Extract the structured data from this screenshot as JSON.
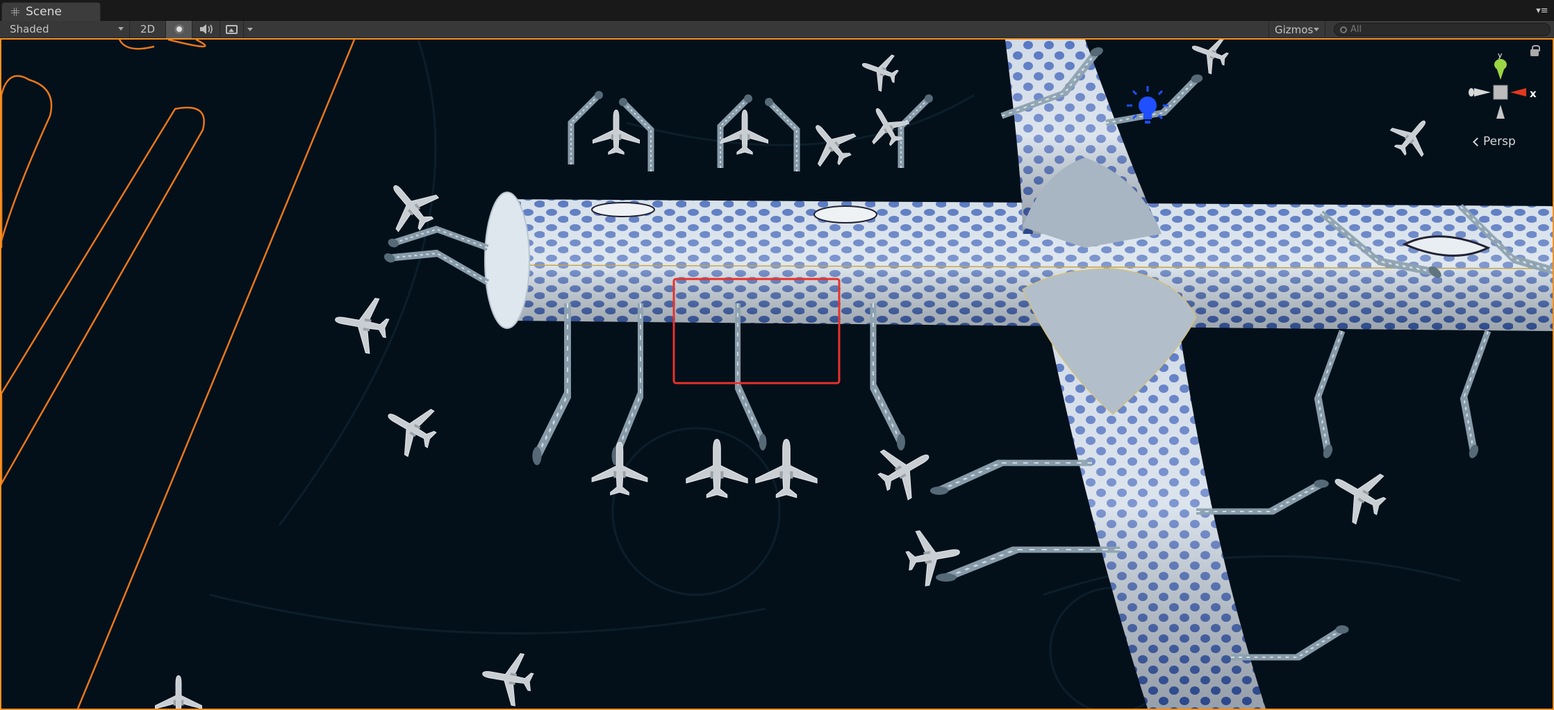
{
  "window": {
    "tab_title": "Scene",
    "tab_icon": "grid-icon",
    "menu_icon": "window-menu-icon"
  },
  "toolbar": {
    "shading_mode": "Shaded",
    "mode_2d_label": "2D",
    "lighting_icon": "scene-lighting-icon",
    "audio_icon": "scene-audio-icon",
    "effects_icon": "scene-effects-icon",
    "gizmos_label": "Gizmos",
    "search_placeholder": "All"
  },
  "viewport": {
    "projection_label": "Persp",
    "orientation_gizmo": {
      "x_axis_label": "x",
      "y_axis_label": "y",
      "axis_colors": {
        "x": "#e0391d",
        "y": "#8fcc3b",
        "z": "#3d6fe0"
      }
    },
    "selection_outline_color": "#f7911e",
    "highlight_box_color": "#e8312b",
    "scene_description_icons": [
      "airplane-icon",
      "light-bulb-icon",
      "terminal-building",
      "jet-bridge"
    ]
  },
  "colors": {
    "background": "#03101a",
    "terminal_blue": "#3f63b8",
    "terminal_light": "#d6e0ea",
    "light_gizmo": "#1f4fff"
  }
}
